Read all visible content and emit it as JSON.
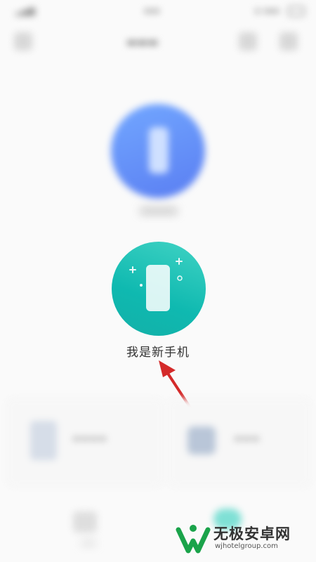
{
  "screen": {
    "new_phone_label": "我是新手机"
  },
  "colors": {
    "new_phone_circle": "#13b0a8",
    "old_phone_circle": "#5a7ef2",
    "annotation_arrow": "#d42a2a"
  },
  "icons": {
    "new_phone": "phone-icon",
    "annotation": "red-arrow-pointing-to-label"
  },
  "watermark": {
    "title": "无极安卓网",
    "url": "wjhotelgroup.com"
  }
}
